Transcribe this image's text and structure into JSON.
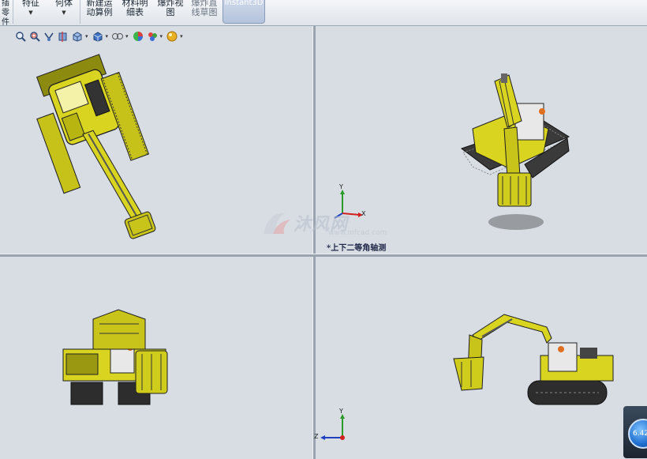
{
  "ribbon": {
    "buttons": [
      {
        "label": "插\n零\n件",
        "has_caret": false
      },
      {
        "label": "特征",
        "has_caret": true
      },
      {
        "label": "何体",
        "has_caret": true
      },
      {
        "label": "新建运\n动算例",
        "has_caret": false
      },
      {
        "label": "材料明\n细表",
        "has_caret": false
      },
      {
        "label": "爆炸视\n图",
        "has_caret": false
      },
      {
        "label": "爆炸直\n线草图",
        "has_caret": false
      }
    ],
    "active_button": "Instant3D"
  },
  "view_toolbar": {
    "icons": [
      "zoom-to-fit-icon",
      "zoom-area-icon",
      "previous-view-icon",
      "section-view-icon",
      "view-orientation-icon",
      "display-style-icon",
      "hide-show-icon",
      "edit-appearance-icon",
      "apply-scene-icon",
      "view-settings-icon"
    ]
  },
  "viewports": {
    "top_right_label": "*上下二等角轴测",
    "triad_labels": {
      "x": "X",
      "y": "Y",
      "z": "Z"
    }
  },
  "watermark": {
    "text": "沐风网",
    "url": "www.mfcad.com"
  },
  "badge": {
    "value": "6.42"
  },
  "colors": {
    "model": "#d8d420",
    "background": "#d8dde4",
    "accent": "#e07020"
  }
}
